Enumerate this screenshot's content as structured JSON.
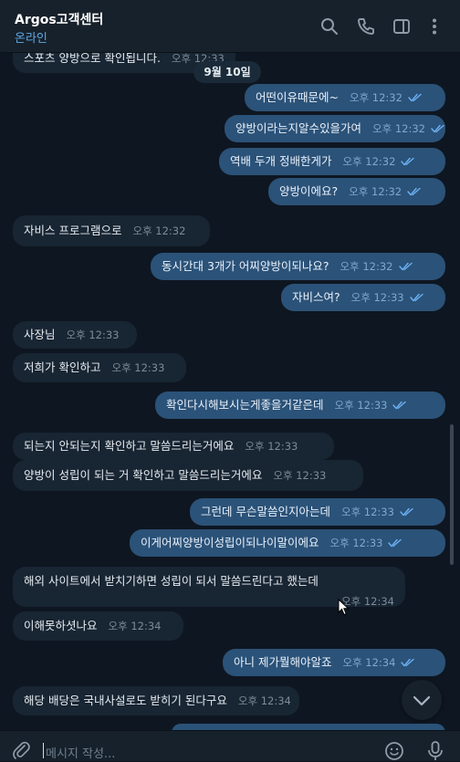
{
  "header": {
    "title": "Argos고객센터",
    "status": "온라인",
    "icons": [
      "search-icon",
      "phone-icon",
      "sidebar-toggle-icon",
      "more-vertical-icon"
    ]
  },
  "date_separator": "9월 10일",
  "top_partial": {
    "text": "스포츠 양방으로 확인됩니다.",
    "time": "오후 12:33"
  },
  "messages": [
    {
      "dir": "out",
      "text": "어떤이유때문에~",
      "time": "오후 12:32",
      "read": true
    },
    {
      "dir": "out",
      "text": "양방이라는지알수있을가여",
      "time": "오후 12:32",
      "read": true
    },
    {
      "dir": "out",
      "text": "역배 두개 정배한게가",
      "time": "오후 12:32",
      "read": true
    },
    {
      "dir": "out",
      "text": "양방이에요?",
      "time": "오후 12:32",
      "read": true
    },
    {
      "dir": "in",
      "text": "자비스 프로그램으로",
      "time": "오후 12:32"
    },
    {
      "dir": "out",
      "text": "동시간대 3개가 어찌양방이되나요?",
      "time": "오후 12:32",
      "read": true
    },
    {
      "dir": "out",
      "text": "자비스여?",
      "time": "오후 12:33",
      "read": true
    },
    {
      "dir": "in",
      "text": "사장님",
      "time": "오후 12:33"
    },
    {
      "dir": "in",
      "text": "저희가 확인하고",
      "time": "오후 12:33"
    },
    {
      "dir": "out",
      "text": "확인다시해보시는게좋을거같은데",
      "time": "오후 12:33",
      "read": true
    },
    {
      "dir": "in",
      "text": "되는지 안되는지 확인하고 말씀드리는거에요",
      "time": "오후 12:33"
    },
    {
      "dir": "in",
      "text": "양방이 성립이 되는 거 확인하고 말씀드리는거에요",
      "time": "오후 12:33"
    },
    {
      "dir": "out",
      "text": "그런데 무슨말씀인지아는데",
      "time": "오후 12:33",
      "read": true
    },
    {
      "dir": "out",
      "text": "이게어찌양방이성립이되나이말이에요",
      "time": "오후 12:33",
      "read": true
    },
    {
      "dir": "in",
      "text": "해외 사이트에서 받치기하면 성립이 되서 말씀드린다고 했는데",
      "time": "오후 12:34"
    },
    {
      "dir": "in",
      "text": "이해못하셧나요",
      "time": "오후 12:34"
    },
    {
      "dir": "out",
      "text": "아니 제가뭘해야알죠",
      "time": "오후 12:34",
      "read": true
    },
    {
      "dir": "in",
      "text": "해당 배당은 국내사설로도 받히기 된다구요",
      "time": "오후 12:34"
    }
  ],
  "composer": {
    "placeholder": "메시지 작성...",
    "icons": [
      "attach-icon",
      "emoji-icon",
      "mic-icon"
    ]
  },
  "colors": {
    "background": "#0e1621",
    "header": "#17212b",
    "incoming_bubble": "#182533",
    "outgoing_bubble": "#2b5278",
    "accent": "#5fa8e6",
    "read_check": "#6ab0f3"
  }
}
